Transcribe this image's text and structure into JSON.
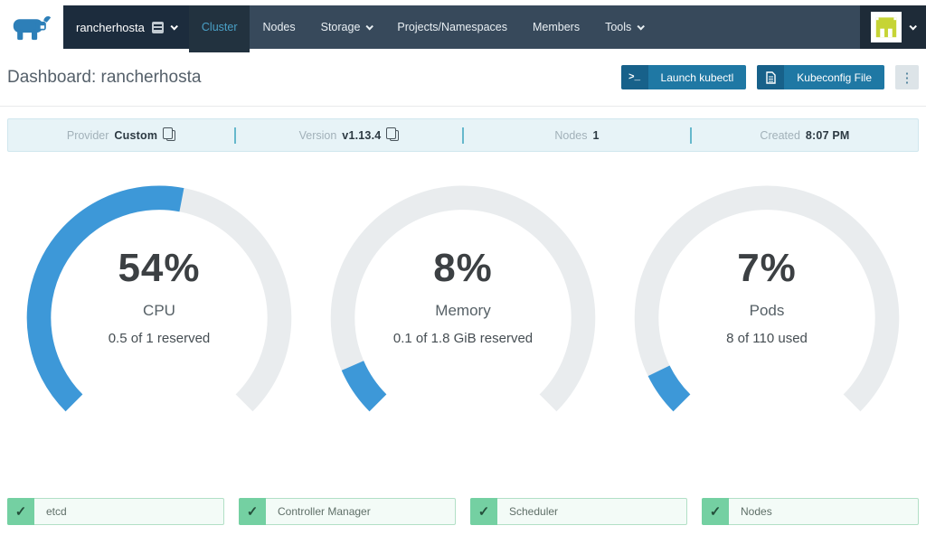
{
  "navbar": {
    "cluster_selector": {
      "name": "rancherhosta"
    },
    "items": [
      {
        "label": "Cluster",
        "active": true,
        "dropdown": false
      },
      {
        "label": "Nodes",
        "active": false,
        "dropdown": false
      },
      {
        "label": "Storage",
        "active": false,
        "dropdown": true
      },
      {
        "label": "Projects/Namespaces",
        "active": false,
        "dropdown": false
      },
      {
        "label": "Members",
        "active": false,
        "dropdown": false
      },
      {
        "label": "Tools",
        "active": false,
        "dropdown": true
      }
    ]
  },
  "header": {
    "title": "Dashboard: rancherhosta",
    "buttons": [
      {
        "label": "Launch kubectl",
        "icon": "terminal-icon"
      },
      {
        "label": "Kubeconfig File",
        "icon": "file-icon"
      }
    ]
  },
  "icons": {
    "terminal_prompt": ">_",
    "ellipsis": "⋮",
    "check": "✓"
  },
  "info_bar": {
    "fields": [
      {
        "label": "Provider",
        "value": "Custom",
        "copy": true
      },
      {
        "label": "Version",
        "value": "v1.13.4",
        "copy": true
      },
      {
        "label": "Nodes",
        "value": "1",
        "copy": false
      },
      {
        "label": "Created",
        "value": "8:07 PM",
        "copy": false
      }
    ]
  },
  "chart_data": [
    {
      "type": "gauge",
      "title": "CPU",
      "percent": 54,
      "detail": "0.5 of 1 reserved",
      "arc_span_degrees": 270,
      "fill_color": "#3d98d8",
      "track_color": "#e9ecee"
    },
    {
      "type": "gauge",
      "title": "Memory",
      "percent": 8,
      "detail": "0.1 of 1.8 GiB reserved",
      "arc_span_degrees": 270,
      "fill_color": "#3d98d8",
      "track_color": "#e9ecee"
    },
    {
      "type": "gauge",
      "title": "Pods",
      "percent": 7,
      "detail": "8 of 110 used",
      "arc_span_degrees": 270,
      "fill_color": "#3d98d8",
      "track_color": "#e9ecee"
    }
  ],
  "component_statuses": [
    {
      "label": "etcd",
      "state": "healthy"
    },
    {
      "label": "Controller Manager",
      "state": "healthy"
    },
    {
      "label": "Scheduler",
      "state": "healthy"
    },
    {
      "label": "Nodes",
      "state": "healthy"
    }
  ],
  "colors": {
    "navbar_bg": "#37495b",
    "selector_bg": "#1c2c3d",
    "active_tab_bg": "#22323f",
    "active_link": "#4aa1c7",
    "accent_blue": "#3d98d8",
    "gauge_track": "#e9ecee",
    "button_bg": "#1f78a4",
    "banner_bg": "#e7f3f7",
    "success_green": "#74d0a2",
    "identicon_yellow": "#c6d435",
    "logo_blue": "#2d7fb8"
  }
}
